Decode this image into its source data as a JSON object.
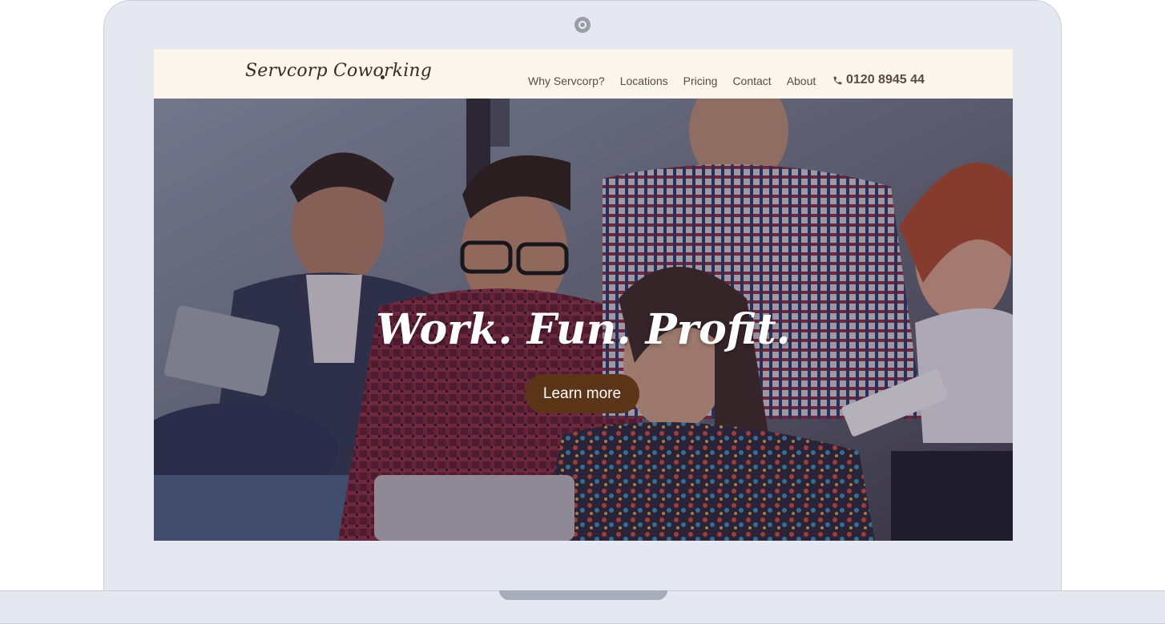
{
  "site": {
    "logo_text": "Servcorp Coworking",
    "nav": [
      {
        "label": "Why Servcorp?"
      },
      {
        "label": "Locations"
      },
      {
        "label": "Pricing"
      },
      {
        "label": "Contact"
      },
      {
        "label": "About"
      }
    ],
    "phone": {
      "icon": "phone-icon",
      "number": "0120 8945 44"
    }
  },
  "hero": {
    "headline": "Work. Fun. Profit.",
    "cta_label": "Learn more",
    "image": "group-of-people-working-together-photo"
  },
  "colors": {
    "navbar_bg": "#fdf6ec",
    "brand_brown": "#5c3519",
    "nav_text": "#5a4a40",
    "laptop_frame": "#e5e8f0"
  }
}
